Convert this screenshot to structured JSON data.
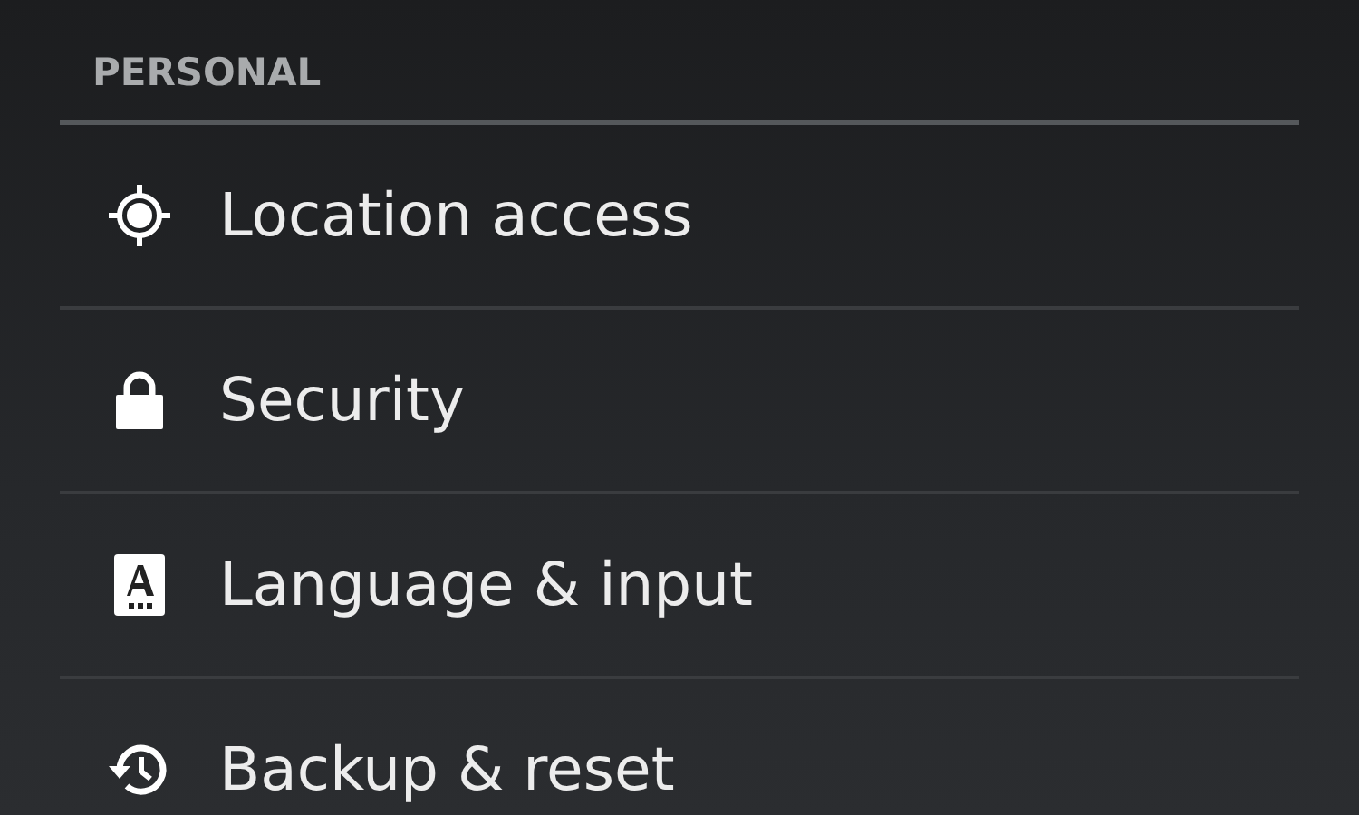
{
  "section": {
    "title": "PERSONAL"
  },
  "items": [
    {
      "label": "Location access",
      "kind": "location"
    },
    {
      "label": "Security",
      "kind": "security"
    },
    {
      "label": "Language & input",
      "kind": "language"
    },
    {
      "label": "Backup & reset",
      "kind": "backup"
    }
  ]
}
